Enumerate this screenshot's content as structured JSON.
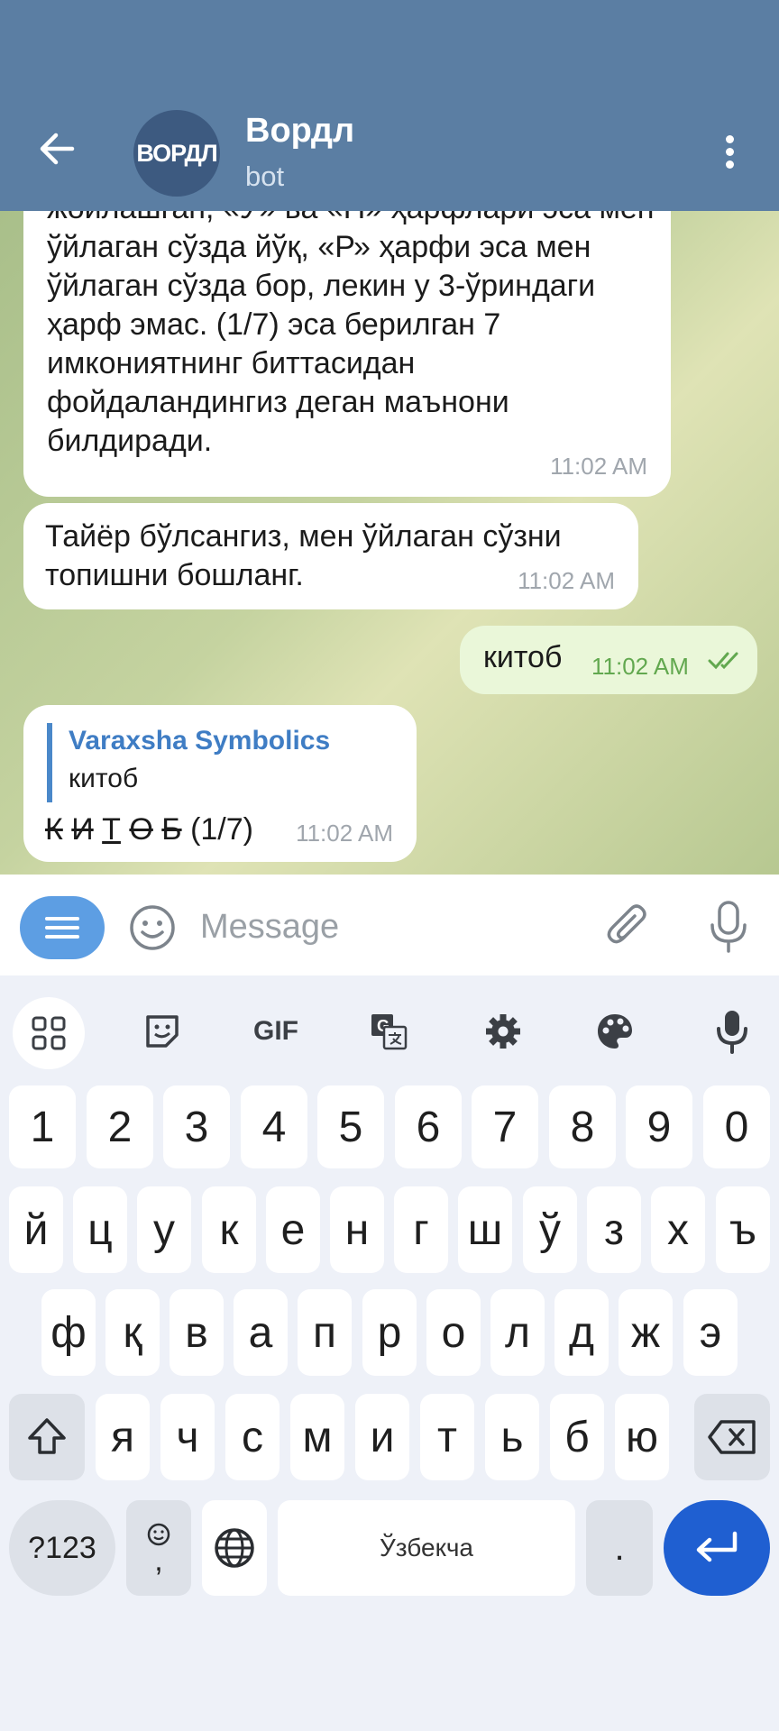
{
  "header": {
    "avatar_text": "ВОРДЛ",
    "title": "Вордл",
    "subtitle": "bot"
  },
  "messages": [
    {
      "text": "жойлашган, «Ў» ва «Н» ҳарфлари эса мен ўйлаган сўзда йўқ, «Р» ҳарфи эса мен ўйлаган сўзда бор, лекин у 3-ўриндаги ҳарф эмас. (1/7) эса берилган 7 имкониятнинг биттасидан фойдаландингиз деган маънони билдиради.",
      "time": "11:02 AM"
    },
    {
      "text": "Тайёр бўлсангиз, мен ўйлаган сўзни топишни бошланг.",
      "time": "11:02 AM"
    },
    {
      "text": "китоб",
      "time": "11:02 AM",
      "outgoing": true
    },
    {
      "reply_name": "Varaxsha Symbolics",
      "reply_text": "китоб",
      "letters": [
        "К",
        "И",
        "Т",
        "О",
        "Б"
      ],
      "attempt": "(1/7)",
      "time": "11:02 AM"
    }
  ],
  "input": {
    "placeholder": "Message"
  },
  "keyboard": {
    "toolbar": {
      "gif": "GIF"
    },
    "row_numbers": [
      "1",
      "2",
      "3",
      "4",
      "5",
      "6",
      "7",
      "8",
      "9",
      "0"
    ],
    "row1": [
      "й",
      "ц",
      "у",
      "к",
      "е",
      "н",
      "г",
      "ш",
      "ў",
      "з",
      "х",
      "ъ"
    ],
    "row2": [
      "ф",
      "қ",
      "в",
      "а",
      "п",
      "р",
      "о",
      "л",
      "д",
      "ж",
      "э"
    ],
    "row3": [
      "я",
      "ч",
      "с",
      "м",
      "и",
      "т",
      "ь",
      "б",
      "ю"
    ],
    "sym_label": "?123",
    "emoji_comma": ",",
    "space_label": "Ўзбекча",
    "period": "."
  },
  "colors": {
    "header": "#5b7ea3",
    "outgoing_bubble": "#eaf7d9",
    "accent": "#1f5fd1"
  }
}
